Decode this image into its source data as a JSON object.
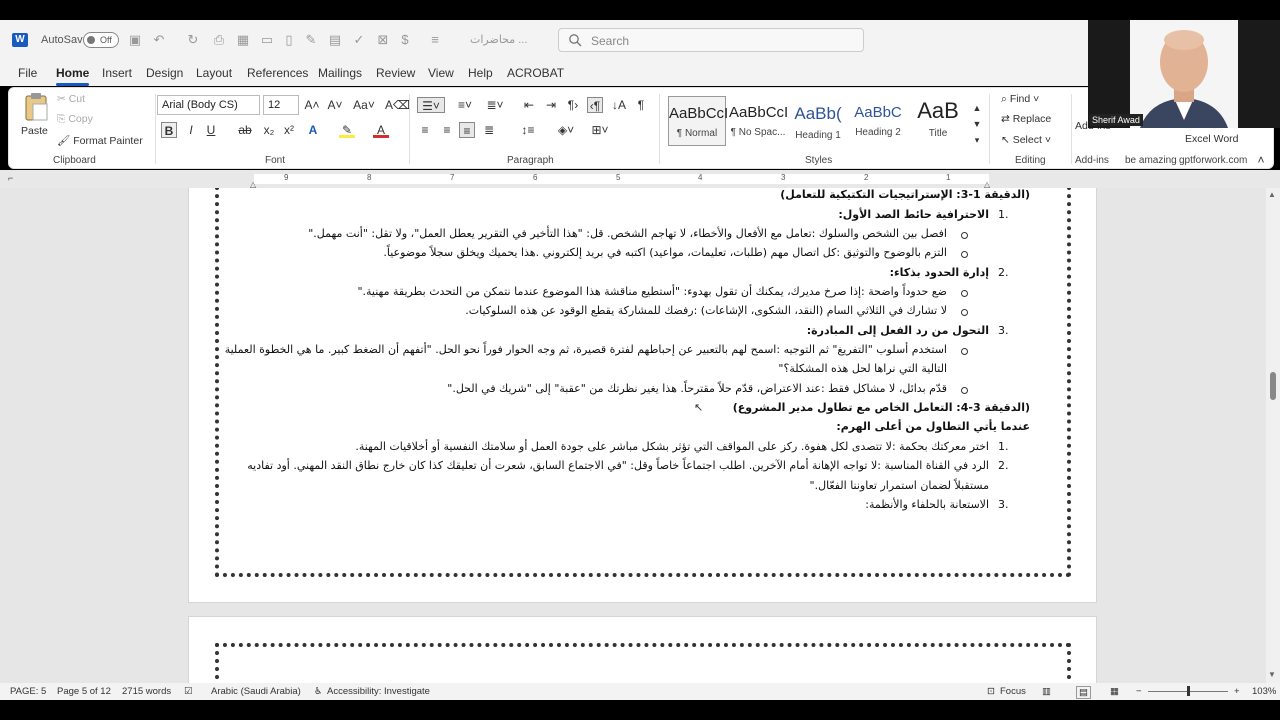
{
  "titlebar": {
    "autosave_label": "AutoSave",
    "autosave_state": "Off",
    "doc_title": "محاضرات ...",
    "search_placeholder": "Search"
  },
  "menu": {
    "tabs": [
      "File",
      "Home",
      "Insert",
      "Design",
      "Layout",
      "References",
      "Mailings",
      "Review",
      "View",
      "Help",
      "ACROBAT"
    ],
    "active": "Home"
  },
  "ribbon": {
    "clipboard": {
      "paste": "Paste",
      "cut": "Cut",
      "copy": "Copy",
      "format_painter": "Format Painter",
      "label": "Clipboard"
    },
    "font": {
      "name": "Arial (Body CS)",
      "size": "12",
      "label": "Font"
    },
    "paragraph": {
      "label": "Paragraph"
    },
    "styles": {
      "label": "Styles",
      "items": [
        {
          "sample": "AaBbCcI",
          "name": "¶ Normal"
        },
        {
          "sample": "AaBbCcI",
          "name": "¶ No Spac..."
        },
        {
          "sample": "AaBb(",
          "name": "Heading 1"
        },
        {
          "sample": "AaBbC",
          "name": "Heading 2"
        },
        {
          "sample": "AaB",
          "name": "Title"
        }
      ]
    },
    "editing": {
      "find": "Find",
      "replace": "Replace",
      "select": "Select",
      "label": "Editing"
    },
    "addins": {
      "label": "Add-ins",
      "partial": "Add-ins"
    },
    "extra": {
      "be_amazing": "be amazing",
      "gpt": "gptforwork.com",
      "excel": "Excel Word"
    }
  },
  "webcam": {
    "name": "Sherif Awad"
  },
  "ruler": {
    "ticks": [
      "9",
      "8",
      "7",
      "6",
      "5",
      "4",
      "3",
      "2",
      "1"
    ]
  },
  "document": {
    "lines": [
      {
        "text": "(الدقيقة 1-3: الإستراتيجيات التكتيكية للتعامل)",
        "bold": true
      },
      {
        "text": "الاحترافية حائط الصد الأول:",
        "bold": true,
        "num": "1."
      },
      {
        "text": "افصل بين الشخص والسلوك :تعامل مع الأفعال والأخطاء، لا تهاجم الشخص. قل: \"هذا التأخير في التقرير يعطل العمل\"، ولا تقل: \"أنت مهمل.\"",
        "bullet": true
      },
      {
        "text": "التزم بالوضوح والتوثيق :كل اتصال مهم (طلبات، تعليمات، مواعيد) اكتبه في بريد إلكتروني .هذا يحميك ويخلق سجلاً موضوعياً.",
        "bullet": true
      },
      {
        "text": "إدارة الحدود بذكاء:",
        "bold": true,
        "num": "2."
      },
      {
        "text": "ضع حدوداً واضحة :إذا صرخ مديرك، يمكنك أن تقول بهدوء: \"أستطيع مناقشة هذا الموضوع عندما نتمكن من التحدث بطريقة مهنية.\"",
        "bullet": true
      },
      {
        "text": "لا تشارك في الثلاثي السام (النقد، الشكوى، الإشاعات) :رفضك للمشاركة يقطع الوقود عن هذه السلوكيات.",
        "bullet": true
      },
      {
        "text": "التحول من رد الفعل إلى المبادرة:",
        "bold": true,
        "num": "3."
      },
      {
        "text": "استخدم أسلوب \"التفريغ\" ثم التوجيه :اسمح لهم بالتعبير عن إحباطهم لفترة قصيرة، ثم وجه الحوار فوراً نحو الحل. \"أتفهم أن الضغط كبير. ما هي الخطوة العملية",
        "bullet": true
      },
      {
        "text": "التالية التي نراها لحل هذه المشكلة؟\""
      },
      {
        "text": "قدّم بدائل، لا مشاكل فقط :عند الاعتراض، قدّم حلاً مقترحاً. هذا يغير نظرتك من \"عقبة\" إلى \"شريك في الحل.\"",
        "bullet": true
      },
      {
        "text": "(الدقيقة 3-4: التعامل الخاص مع تطاول مدير المشروع)",
        "bold": true
      },
      {
        "text": "عندما يأتي التطاول من أعلى الهرم:",
        "bold": true
      },
      {
        "text": "اختر معركتك بحكمة :لا تتصدى لكل هفوة. ركز على المواقف التي تؤثر بشكل مباشر على جودة العمل أو سلامتك النفسية أو أخلاقيات المهنة.",
        "num": "1."
      },
      {
        "text": "الرد في القناة المناسبة :لا تواجه الإهانة أمام الآخرين. اطلب اجتماعاً خاصاً وقل: \"في الاجتماع السابق، شعرت أن تعليقك كذا كان خارج نطاق النقد المهني. أود تفاديه",
        "num": "2."
      },
      {
        "text": "مستقبلاً لضمان استمرار تعاوننا الفعّال.\""
      },
      {
        "text": "الاستعانة بالحلفاء والأنظمة:",
        "num": "3."
      }
    ]
  },
  "statusbar": {
    "page": "PAGE: 5",
    "page_of": "Page 5 of 12",
    "words": "2715 words",
    "language": "Arabic (Saudi Arabia)",
    "accessibility": "Accessibility: Investigate",
    "focus": "Focus",
    "zoom": "103%"
  }
}
